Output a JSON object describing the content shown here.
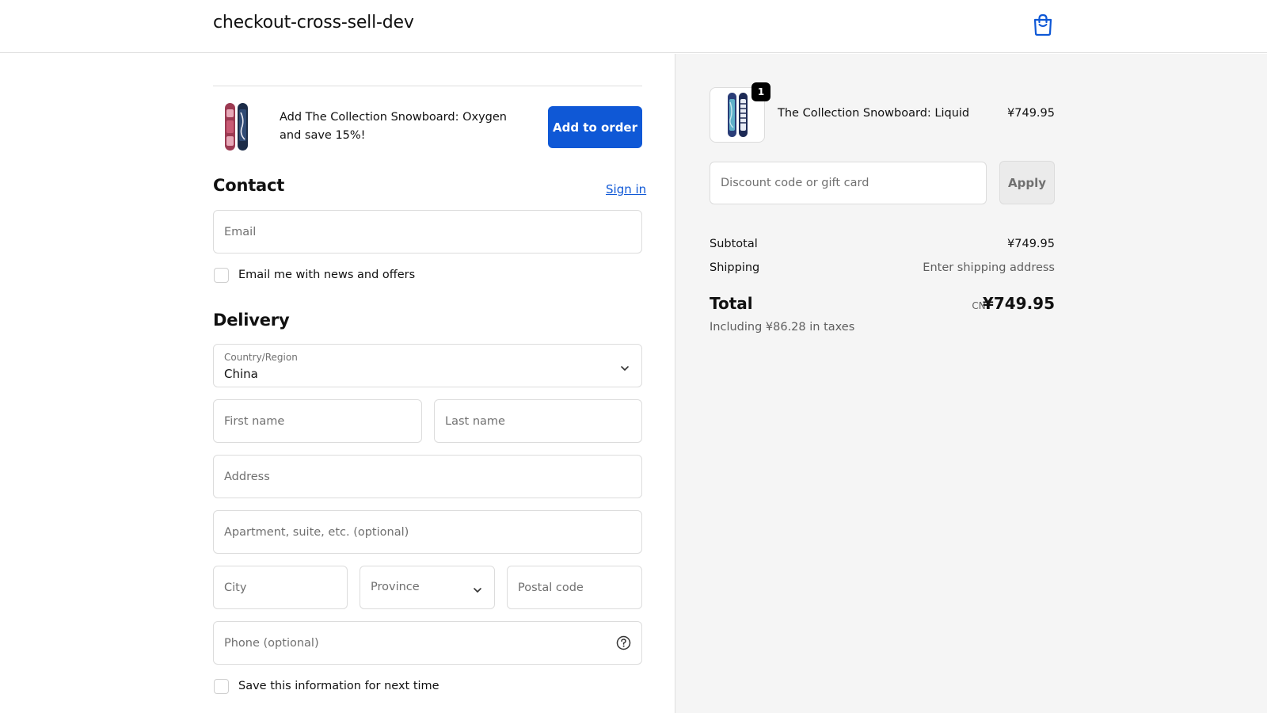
{
  "header": {
    "store_name": "checkout-cross-sell-dev",
    "cart_icon": "shopping-bag-icon"
  },
  "upsell": {
    "text": "Add The Collection Snowboard: Oxygen and save 15%!",
    "button_label": "Add to order"
  },
  "contact": {
    "title": "Contact",
    "sign_in_label": "Sign in",
    "email_placeholder": "Email",
    "newsletter_label": "Email me with news and offers"
  },
  "delivery": {
    "title": "Delivery",
    "country_label": "Country/Region",
    "country_value": "China",
    "first_name_placeholder": "First name",
    "last_name_placeholder": "Last name",
    "address_placeholder": "Address",
    "apartment_placeholder": "Apartment, suite, etc. (optional)",
    "city_placeholder": "City",
    "province_placeholder": "Province",
    "postal_placeholder": "Postal code",
    "phone_placeholder": "Phone (optional)",
    "save_info_label": "Save this information for next time"
  },
  "order": {
    "quantity_badge": "1",
    "product_name": "The Collection Snowboard: Liquid",
    "product_price": "¥749.95",
    "discount_placeholder": "Discount code or gift card",
    "apply_label": "Apply",
    "subtotal_label": "Subtotal",
    "subtotal_value": "¥749.95",
    "shipping_label": "Shipping",
    "shipping_value": "Enter shipping address",
    "total_label": "Total",
    "total_currency": "CNY",
    "total_value": "¥749.95",
    "taxes_text": "Including ¥86.28 in taxes"
  },
  "colors": {
    "accent": "#0f58d6",
    "panel_bg": "#f5f5f5",
    "border": "#dcdcdc"
  }
}
